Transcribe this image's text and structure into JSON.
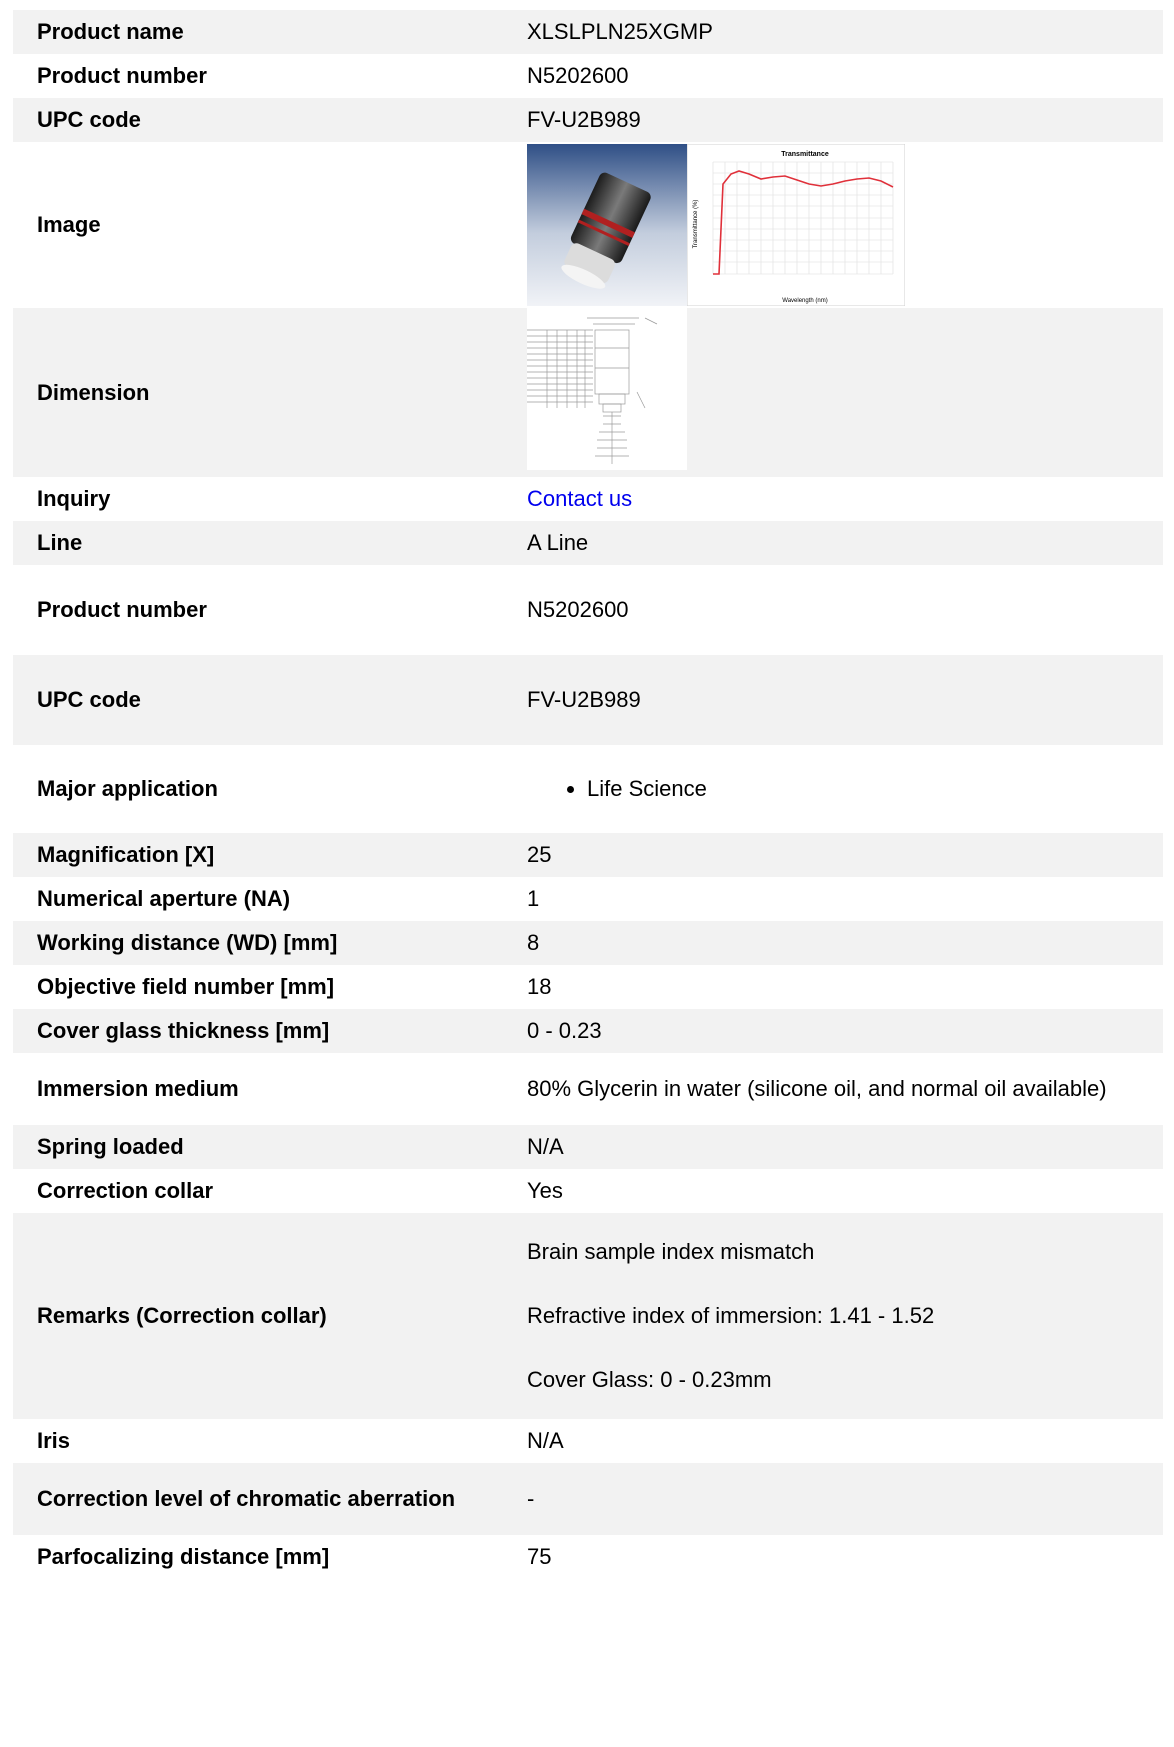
{
  "rows": [
    {
      "label": "Product name",
      "value": "XLSLPLN25XGMP"
    },
    {
      "label": "Product number",
      "value": "N5202600"
    },
    {
      "label": "UPC code",
      "value": "FV-U2B989"
    },
    {
      "label": "Image"
    },
    {
      "label": "Dimension"
    },
    {
      "label": "Inquiry",
      "value": "Contact us"
    },
    {
      "label": "Line",
      "value": "A Line"
    },
    {
      "label": "Product number",
      "value": "N5202600"
    },
    {
      "label": "UPC code",
      "value": "FV-U2B989"
    },
    {
      "label": "Major application",
      "items": [
        "Life Science"
      ]
    },
    {
      "label": "Magnification [X]",
      "value": "25"
    },
    {
      "label": "Numerical aperture (NA)",
      "value": "1"
    },
    {
      "label": "Working distance (WD) [mm]",
      "value": "8"
    },
    {
      "label": "Objective field number [mm]",
      "value": "18"
    },
    {
      "label": "Cover glass thickness [mm]",
      "value": "0 - 0.23"
    },
    {
      "label": "Immersion medium",
      "value": "80% Glycerin in water (silicone oil, and normal oil available)"
    },
    {
      "label": "Spring loaded",
      "value": "N/A"
    },
    {
      "label": "Correction collar",
      "value": "Yes"
    },
    {
      "label": "Remarks (Correction collar)",
      "lines": [
        "Brain sample index mismatch",
        "Refractive index of immersion: 1.41 - 1.52",
        "Cover Glass: 0 - 0.23mm"
      ]
    },
    {
      "label": "Iris",
      "value": "N/A"
    },
    {
      "label": "Correction level of chromatic aberration",
      "value": "-"
    },
    {
      "label": "Parfocalizing distance [mm]",
      "value": "75"
    }
  ],
  "images": {
    "chart_title": "Transmittance",
    "chart_ylabel": "Transmittance (%)",
    "chart_xlabel": "Wavelength (nm)"
  },
  "colors": {
    "row_alt": "#f2f2f2",
    "link": "#0000ee",
    "curve": "#e0303a"
  }
}
